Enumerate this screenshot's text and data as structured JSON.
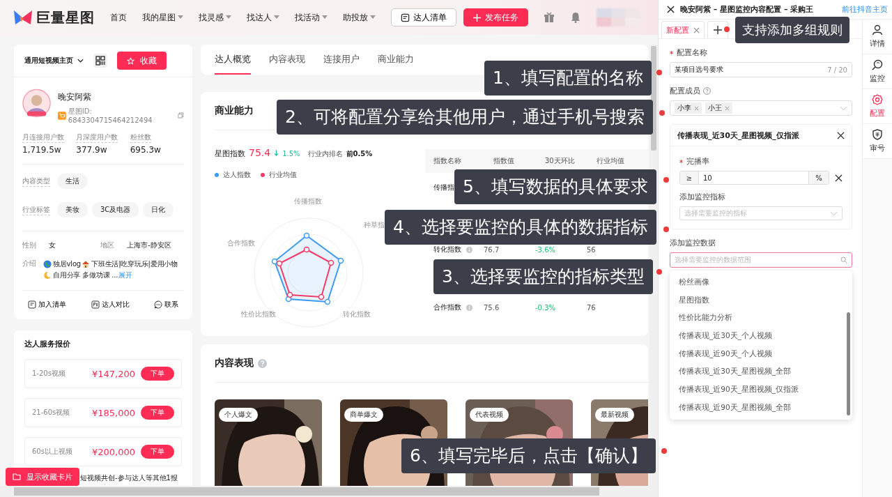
{
  "nav": {
    "logo": "巨量星图",
    "items": [
      {
        "label": "首页",
        "dropdown": false
      },
      {
        "label": "我的星图",
        "dropdown": true
      },
      {
        "label": "找灵感",
        "dropdown": true
      },
      {
        "label": "找达人",
        "dropdown": true
      },
      {
        "label": "找活动",
        "dropdown": true
      },
      {
        "label": "助投放",
        "dropdown": true
      }
    ],
    "list_button": "达人清单",
    "publish_button": "发布任务"
  },
  "profile_card": {
    "page_select": "通用短视频主页",
    "favorite_button": "收藏",
    "name": "晚安阿紫",
    "id": "星图ID: 6843304715464212494",
    "stats": [
      {
        "label": "月连接用户数",
        "value": "1,719.5w"
      },
      {
        "label": "月深度用户数",
        "value": "377.9w"
      },
      {
        "label": "粉丝数",
        "value": "695.3w"
      }
    ],
    "tag_groups": [
      {
        "label": "内容类型",
        "tags": [
          "生活"
        ]
      },
      {
        "label": "行业标签",
        "tags": [
          "美妆",
          "3C及电器",
          "日化"
        ]
      }
    ],
    "facts": [
      {
        "label": "性别",
        "value": "女"
      },
      {
        "label": "地区",
        "value": "上海市-静安区"
      }
    ],
    "intro_label": "介绍",
    "intro_parts": [
      {
        "kind": "globe",
        "text": "独居vlog"
      },
      {
        "kind": "house",
        "text": "下班生活|吃穿玩乐|爱用小物"
      },
      {
        "kind": "moon",
        "text": "自用分享 多做功课 ..."
      }
    ],
    "intro_link": "展开",
    "actions": [
      {
        "kind": "list",
        "label": "加入清单"
      },
      {
        "kind": "compare",
        "label": "达人对比"
      },
      {
        "kind": "chat",
        "label": "联系"
      }
    ]
  },
  "price_card": {
    "title": "达人服务报价",
    "rows": [
      {
        "label": "1-20s视频",
        "price": "¥147,200",
        "button": "下单"
      },
      {
        "label": "21-60s视频",
        "price": "¥185,000",
        "button": "下单"
      },
      {
        "label": "60s以上视频",
        "price": "¥200,000",
        "button": "下单"
      }
    ],
    "note": "短视频共创-参与达人等其他1报"
  },
  "float_button": "显示收藏卡片",
  "center_tabs": [
    {
      "label": "达人概览",
      "selected": true
    },
    {
      "label": "内容表现",
      "selected": false
    },
    {
      "label": "连接用户",
      "selected": false
    },
    {
      "label": "商业能力",
      "selected": false
    }
  ],
  "business": {
    "title": "商业能力",
    "index_label": "星图指数",
    "index_value": "75.4",
    "change": "1.5%",
    "rank_label": "行业内排名",
    "rank_value": "前0.5%",
    "legend": [
      {
        "label": "达人指数",
        "color": "#3e9bf3"
      },
      {
        "label": "行业均值",
        "color": "#f23c6a"
      }
    ],
    "radar_labels": [
      "传播指数",
      "种草指",
      "合作指数",
      "性价比指数",
      "转化指数"
    ],
    "table": {
      "columns": [
        "指数名称",
        "指数值",
        "30天环比",
        "行业均值"
      ],
      "rows": [
        {
          "cells": [
            "传播指"
          ]
        },
        {
          "cells": [
            "转化指数",
            "76.7",
            "-3.6%",
            "56"
          ],
          "info": true
        },
        {
          "cells": [
            "合作指数",
            "75.6",
            "-0.3%",
            "76"
          ],
          "info": true
        }
      ]
    }
  },
  "content": {
    "title": "内容表现",
    "videos": [
      {
        "kind": "picture",
        "tag": "个人爆文"
      },
      {
        "kind": "picture",
        "tag": "商单爆文"
      },
      {
        "kind": "picture",
        "tag": "代表视频"
      },
      {
        "kind": "picture",
        "tag": "最新视频"
      }
    ]
  },
  "panel": {
    "title": "晚安阿紫 – 星图监控内容配置 – 采购王",
    "link": "前往抖音主页",
    "tabs": [
      {
        "label": "新配置",
        "selected": true
      }
    ],
    "side_tabs": [
      {
        "kind": "person",
        "label": "详情",
        "selected": false
      },
      {
        "kind": "search",
        "label": "监控",
        "selected": false
      },
      {
        "kind": "gear",
        "label": "配置",
        "selected": true
      },
      {
        "kind": "shield",
        "label": "审号",
        "selected": false
      }
    ],
    "name_label": "配置名称",
    "name_required": true,
    "name_value": "某项目选号要求",
    "name_count": "7 / 20",
    "members_label": "配置成员",
    "members": [
      "小李",
      "小王"
    ],
    "rule_card": {
      "title": "传播表现_近30天_星图视频_仅指派",
      "metric_label": "完播率",
      "metric_required": true,
      "operator": "≥",
      "value": "10",
      "unit": "%",
      "indicator_label": "添加监控指标",
      "indicator_placeholder": "选择需要监控的指标"
    },
    "data_label": "添加监控数据",
    "data_placeholder": "选择需要监控的数据范围",
    "options": [
      "粉丝画像",
      "星图指数",
      "性价比能力分析",
      "传播表现_近30天_个人视频",
      "传播表现_近90天_个人视频",
      "传播表现_近30天_星图视频_全部",
      "传播表现_近90天_星图视频_仅指派",
      "传播表现_近90天_星图视频_全部"
    ]
  },
  "callouts": [
    {
      "kind": "tabs",
      "text": "支持添加多组规则"
    },
    {
      "kind": "name",
      "text": "1、填写配置的名称"
    },
    {
      "kind": "members",
      "text": "2、可将配置分享给其他用户，通过手机号搜索"
    },
    {
      "kind": "value",
      "text": "5、填写数据的具体要求"
    },
    {
      "kind": "indicator",
      "text": "4、选择要监控的具体的数据指标"
    },
    {
      "kind": "data",
      "text": "3、选择要监控的指标类型"
    },
    {
      "kind": "confirm",
      "text": "6、填写完毕后，点击【确认】"
    }
  ]
}
